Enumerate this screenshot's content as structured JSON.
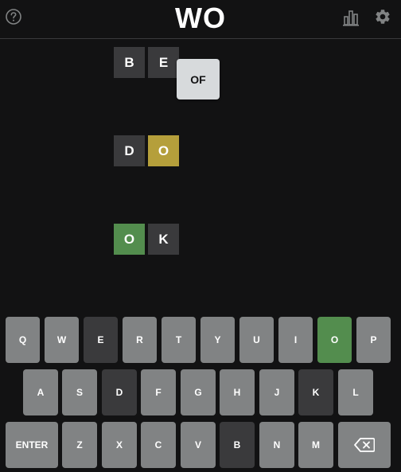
{
  "header": {
    "title": "WO"
  },
  "icons": {
    "help": "help-circle-icon",
    "stats": "bar-chart-icon",
    "settings": "gear-icon"
  },
  "colors": {
    "background": "#121213",
    "absent": "#3a3a3c",
    "present": "#b59f3b",
    "correct": "#538d4e",
    "key": "#818384"
  },
  "board": {
    "rows": [
      {
        "tiles": [
          {
            "letter": "B",
            "state": "absent"
          },
          {
            "letter": "E",
            "state": "absent"
          }
        ]
      },
      {
        "tiles": [
          {
            "letter": "D",
            "state": "absent"
          },
          {
            "letter": "O",
            "state": "present"
          }
        ]
      },
      {
        "tiles": [
          {
            "letter": "O",
            "state": "correct"
          },
          {
            "letter": "K",
            "state": "absent"
          }
        ]
      }
    ]
  },
  "popup": {
    "text": "OF"
  },
  "keyboard": {
    "row1": [
      {
        "label": "Q",
        "state": "unused"
      },
      {
        "label": "W",
        "state": "unused"
      },
      {
        "label": "E",
        "state": "absent"
      },
      {
        "label": "R",
        "state": "unused"
      },
      {
        "label": "T",
        "state": "unused"
      },
      {
        "label": "Y",
        "state": "unused"
      },
      {
        "label": "U",
        "state": "unused"
      },
      {
        "label": "I",
        "state": "unused"
      },
      {
        "label": "O",
        "state": "correct"
      },
      {
        "label": "P",
        "state": "unused"
      }
    ],
    "row2": [
      {
        "label": "A",
        "state": "unused"
      },
      {
        "label": "S",
        "state": "unused"
      },
      {
        "label": "D",
        "state": "absent"
      },
      {
        "label": "F",
        "state": "unused"
      },
      {
        "label": "G",
        "state": "unused"
      },
      {
        "label": "H",
        "state": "unused"
      },
      {
        "label": "J",
        "state": "unused"
      },
      {
        "label": "K",
        "state": "absent"
      },
      {
        "label": "L",
        "state": "unused"
      }
    ],
    "row3": [
      {
        "label": "ENTER",
        "state": "unused"
      },
      {
        "label": "Z",
        "state": "unused"
      },
      {
        "label": "X",
        "state": "unused"
      },
      {
        "label": "C",
        "state": "unused"
      },
      {
        "label": "V",
        "state": "unused"
      },
      {
        "label": "B",
        "state": "absent"
      },
      {
        "label": "N",
        "state": "unused"
      },
      {
        "label": "M",
        "state": "unused"
      }
    ],
    "backspace_icon": "backspace-icon"
  }
}
